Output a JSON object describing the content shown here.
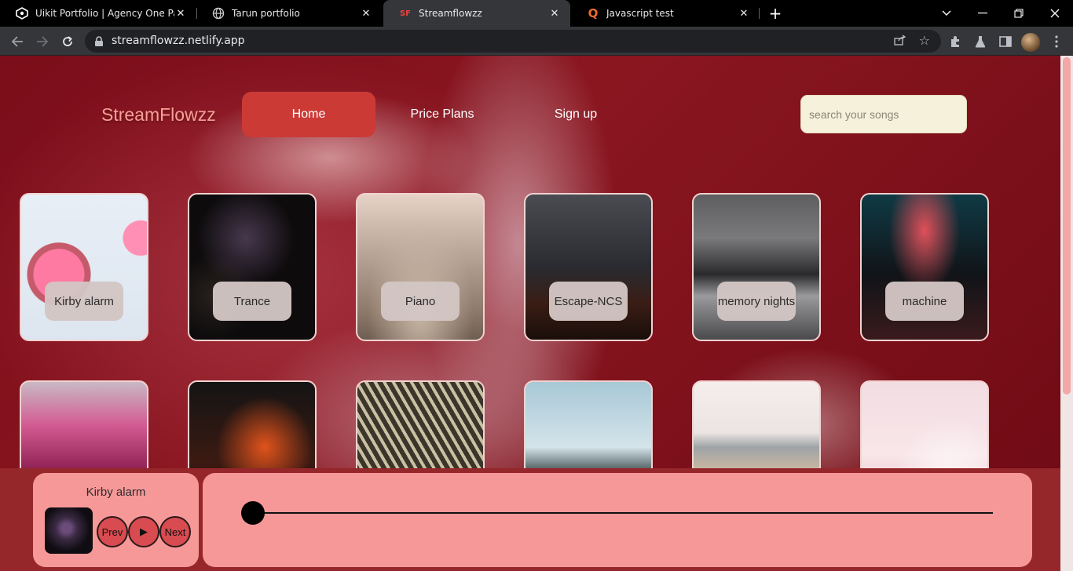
{
  "browser": {
    "tabs": [
      {
        "title": "Uikit Portfolio | Agency One Page",
        "favicon": "uikit-icon"
      },
      {
        "title": "Tarun portfolio",
        "favicon": "globe-icon"
      },
      {
        "title": "Streamflowzz",
        "favicon": "sf-icon",
        "favicon_text": "SF",
        "active": true
      },
      {
        "title": "Javascript test",
        "favicon": "q-icon",
        "favicon_text": "Q"
      }
    ],
    "url": "streamflowzz.netlify.app"
  },
  "site": {
    "logo": "StreamFlowzz",
    "nav": [
      "Home",
      "Price Plans",
      "Sign up"
    ],
    "active_nav": "Home",
    "search_placeholder": "search your songs"
  },
  "songs_row1": [
    "Kirby alarm",
    "Trance",
    "Piano",
    "Escape-NCS",
    "memory nights",
    "machine"
  ],
  "player": {
    "now_playing": "Kirby alarm",
    "prev_label": "Prev",
    "play_icon": "▶",
    "next_label": "Next",
    "progress": 0
  },
  "colors": {
    "accent": "#cc3a36",
    "panel": "#f79898",
    "logo": "#f7a097"
  }
}
